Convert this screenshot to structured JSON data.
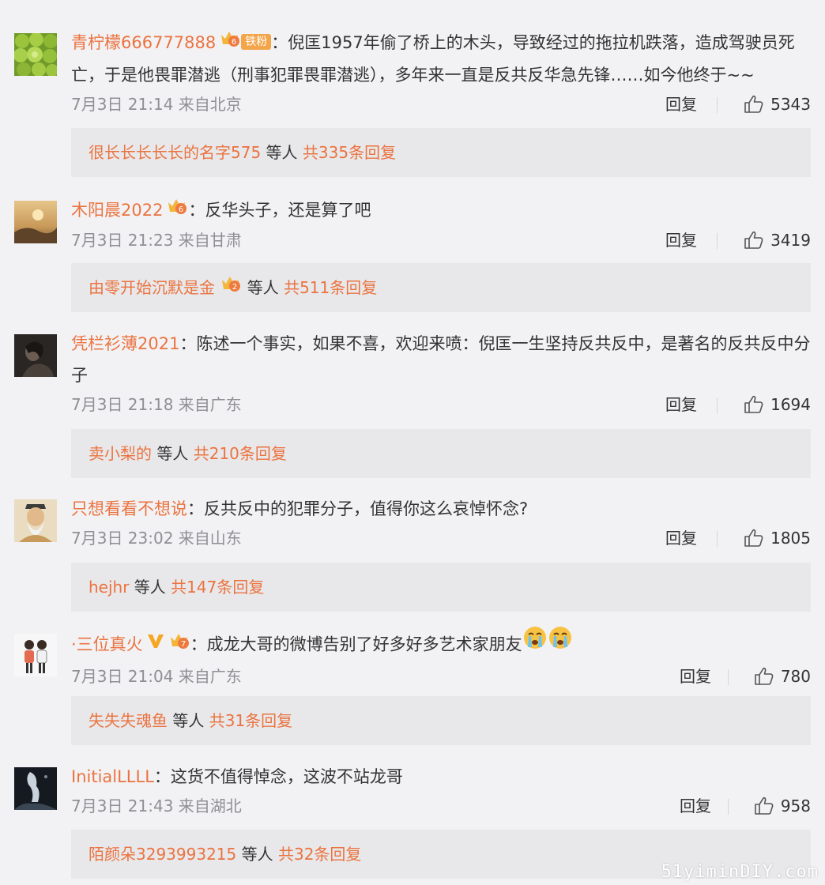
{
  "reply_label": "回复",
  "others_label": "等人",
  "watermark": "51yiminDIY.com",
  "colors": {
    "username": "#eb7340",
    "meta": "#8f8f94",
    "reply_bg": "#e8e8ea",
    "page_bg": "#f2f2f4"
  },
  "comments": [
    {
      "user": "青柠檬666777888",
      "badges": [
        "crown-level-6-icon",
        "tiefen-badge"
      ],
      "badge_text": "铁粉",
      "text": "：倪匡1957年偷了桥上的木头，导致经过的拖拉机跌落，造成驾驶员死亡，于是他畏罪潜逃（刑事犯罪畏罪潜逃），多年来一直是反共反华急先锋……如今他终于~~",
      "time": "7月3日 21:14 来自北京",
      "likes": "5343",
      "reply_user": "很长长长长长的名字575",
      "reply_total": "共335条回复"
    },
    {
      "user": "木阳晨2022",
      "badges": [
        "crown-level-6-icon"
      ],
      "text": "：反华头子，还是算了吧",
      "time": "7月3日 21:23 来自甘肃",
      "likes": "3419",
      "reply_user": "由零开始沉默是金",
      "reply_total": "共511条回复"
    },
    {
      "user": "凭栏衫薄2021",
      "badges": [],
      "text": "：陈述一个事实，如果不喜，欢迎来喷：倪匡一生坚持反共反中，是著名的反共反中分子",
      "time": "7月3日 21:18 来自广东",
      "likes": "1694",
      "reply_user": "卖小梨的",
      "reply_total": "共210条回复"
    },
    {
      "user": "只想看看不想说",
      "badges": [],
      "text": "：反共反中的犯罪分子，值得你这么哀悼怀念?",
      "time": "7月3日 23:02 来自山东",
      "likes": "1805",
      "reply_user": "hejhr",
      "reply_total": "共147条回复"
    },
    {
      "user": "·三位真火",
      "badges": [
        "verified-v-icon",
        "crown-level-7-icon"
      ],
      "text": "：成龙大哥的微博告别了好多好多艺术家朋友",
      "emojis": [
        "crying-face-icon",
        "crying-face-icon"
      ],
      "time": "7月3日 21:04 来自广东",
      "likes": "780",
      "reply_user": "失失失魂鱼",
      "reply_total": "共31条回复"
    },
    {
      "user": "InitialLLLL",
      "badges": [],
      "text": "：这货不值得悼念，这波不站龙哥",
      "time": "7月3日 21:43 来自湖北",
      "likes": "958",
      "reply_user": "陌颜朵3293993215",
      "reply_total": "共32条回复"
    }
  ]
}
